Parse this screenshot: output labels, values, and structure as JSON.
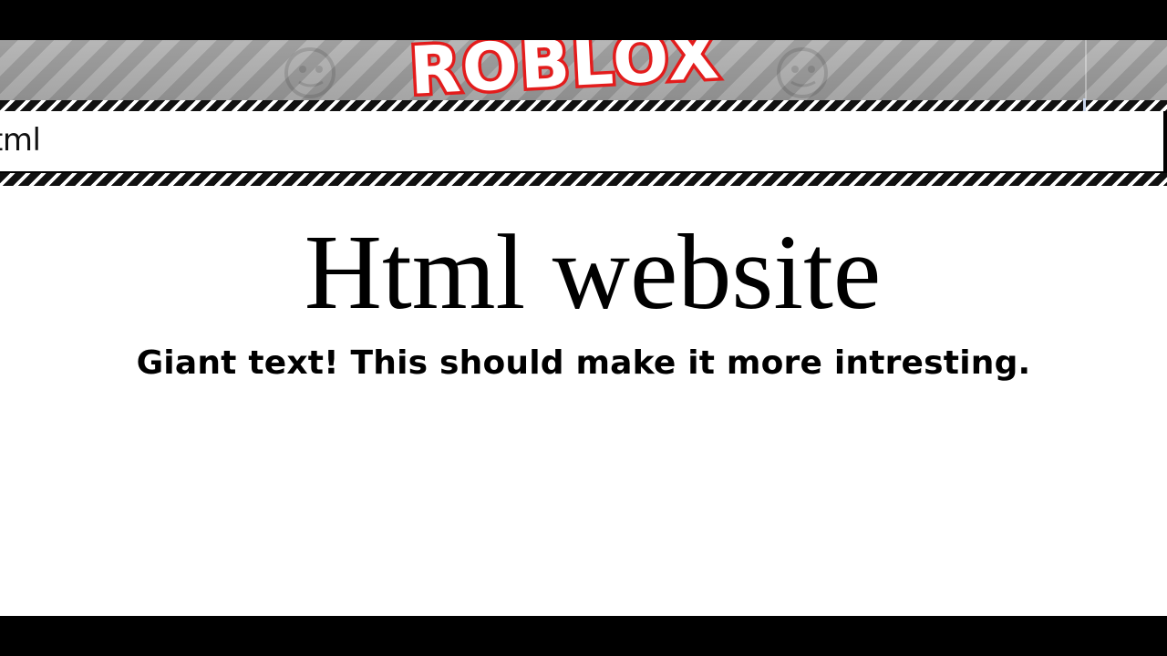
{
  "banner": {
    "logo_text": "ROBLOX",
    "logo_color": "#e31c1c",
    "stripe_colors": [
      "#9a9a9a",
      "#b3b3b3"
    ]
  },
  "url_bar": {
    "value": "tml"
  },
  "page": {
    "heading": "Html website"
  },
  "caption": {
    "text": "Giant text! This should make it more intresting."
  }
}
